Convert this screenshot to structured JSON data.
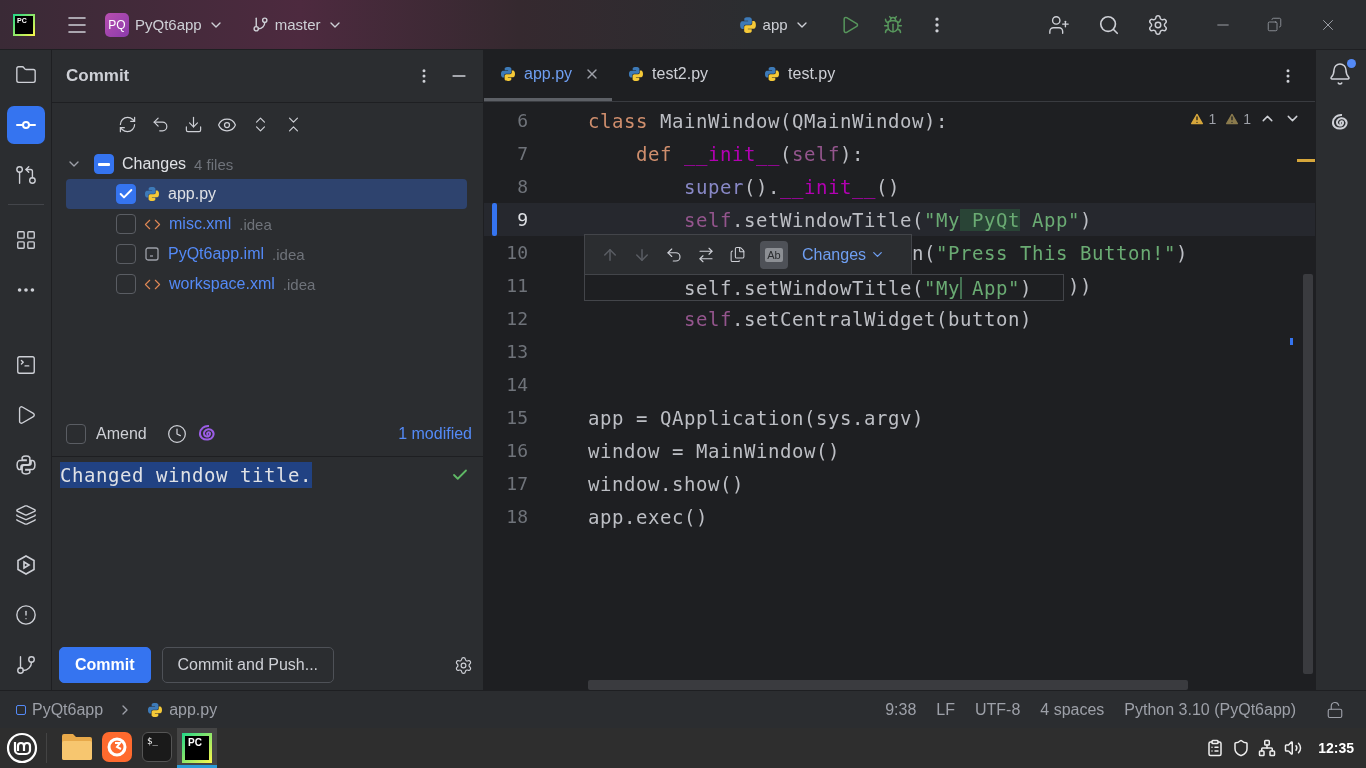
{
  "title_bar": {
    "logo_text": "PC",
    "project": {
      "badge": "PQ",
      "name": "PyQt6app"
    },
    "branch": "master",
    "run_config": "app"
  },
  "tool_strip": {
    "top": [
      {
        "selected": false
      },
      {
        "selected": true
      },
      {
        "selected": false
      },
      {
        "selected": false
      },
      {
        "selected": false
      }
    ],
    "bottom": [
      {
        "selected": false
      },
      {
        "selected": false
      },
      {
        "selected": false
      },
      {
        "selected": false
      },
      {
        "selected": false
      },
      {
        "selected": false
      },
      {
        "selected": false
      }
    ]
  },
  "commit_panel": {
    "title": "Commit",
    "group": {
      "label": "Changes",
      "count": "4 files",
      "expanded": true,
      "partial": true
    },
    "files": [
      {
        "name": "app.py",
        "kind": "python",
        "checked": true,
        "selected": true
      },
      {
        "name": "misc.xml",
        "dir": ".idea",
        "kind": "xml",
        "checked": false,
        "selected": false
      },
      {
        "name": "PyQt6app.iml",
        "dir": ".idea",
        "kind": "iml",
        "checked": false,
        "selected": false
      },
      {
        "name": "workspace.xml",
        "dir": ".idea",
        "kind": "xml",
        "checked": false,
        "selected": false
      }
    ],
    "amend": {
      "label": "Amend",
      "checked": false
    },
    "modified_link": "1 modified",
    "message": "Changed window title.",
    "buttons": [
      {
        "label": "Commit",
        "kind": "primary"
      },
      {
        "label": "Commit and Push...",
        "kind": "secondary"
      }
    ]
  },
  "editor": {
    "tabs": [
      {
        "label": "app.py",
        "selected": true
      },
      {
        "label": "test2.py",
        "selected": false
      },
      {
        "label": "test.py",
        "selected": false
      }
    ],
    "inspections": [
      {
        "count": "1",
        "kind": "warning"
      },
      {
        "count": "1",
        "kind": "weak_warning"
      }
    ],
    "lines": [
      {
        "number": "6",
        "tokens": [
          {
            "t": "class ",
            "kind": "keyword"
          },
          {
            "t": "MainWindow(QMainWindow):",
            "kind": "plain"
          }
        ]
      },
      {
        "number": "7",
        "tokens": [
          {
            "t": "    def ",
            "kind": "keyword"
          },
          {
            "t": "__init__",
            "kind": "magic"
          },
          {
            "t": "(",
            "kind": "plain"
          },
          {
            "t": "self",
            "kind": "self"
          },
          {
            "t": "):",
            "kind": "plain"
          }
        ]
      },
      {
        "number": "8",
        "tokens": [
          {
            "t": "        super",
            "kind": "builtin"
          },
          {
            "t": "().",
            "kind": "plain"
          },
          {
            "t": "__init__",
            "kind": "magic"
          },
          {
            "t": "()",
            "kind": "plain"
          }
        ]
      },
      {
        "number": "9",
        "current": true,
        "changed": true,
        "tokens": [
          {
            "t": "        self",
            "kind": "self"
          },
          {
            "t": ".setWindowTitle(",
            "kind": "plain"
          },
          {
            "t": "\"My",
            "kind": "string"
          },
          {
            "t": " PyQt",
            "kind": "string",
            "highlight": true
          },
          {
            "t": " App\"",
            "kind": "string"
          },
          {
            "t": ")",
            "kind": "plain"
          }
        ]
      },
      {
        "number": "10",
        "tokens": [
          {
            "t": "                           n(",
            "kind": "plain"
          },
          {
            "t": "\"Press This Button!\"",
            "kind": "string"
          },
          {
            "t": ")",
            "kind": "plain"
          }
        ]
      },
      {
        "number": "11",
        "tokens": [
          {
            "t": "                                        ))",
            "kind": "plain"
          }
        ]
      },
      {
        "number": "12",
        "tokens": [
          {
            "t": "        self",
            "kind": "self"
          },
          {
            "t": ".setCentralWidget(button)",
            "kind": "plain"
          }
        ]
      },
      {
        "number": "13"
      },
      {
        "number": "14"
      },
      {
        "number": "15",
        "tokens": [
          {
            "t": "app = QApplication(sys.argv)",
            "kind": "plain"
          }
        ]
      },
      {
        "number": "16",
        "tokens": [
          {
            "t": "window = MainWindow()",
            "kind": "plain"
          }
        ]
      },
      {
        "number": "17",
        "tokens": [
          {
            "t": "window.show()",
            "kind": "plain"
          }
        ]
      },
      {
        "number": "18",
        "tokens": [
          {
            "t": "app.exec()",
            "kind": "plain"
          }
        ]
      }
    ],
    "diff_popup": {
      "ignore_case": {
        "label": "Ab",
        "on": true
      },
      "dropdown": "Changes",
      "tokens": [
        {
          "t": "self.setWindowTitle(",
          "kind": "plain"
        },
        {
          "t": "\"My",
          "kind": "string"
        },
        {
          "t": " App\"",
          "kind": "string",
          "gap_before": true
        },
        {
          "t": ")",
          "kind": "plain"
        }
      ]
    }
  },
  "status_bar": {
    "breadcrumbs": [
      {
        "label": "PyQt6app",
        "kind": "module"
      },
      {
        "label": "app.py",
        "kind": "python"
      }
    ],
    "items": [
      "9:38",
      "LF",
      "UTF-8",
      "4 spaces",
      "Python 3.10 (PyQt6app)"
    ]
  },
  "taskbar": {
    "apps": [
      {
        "kind": "files",
        "active": false
      },
      {
        "kind": "browser",
        "active": false
      },
      {
        "kind": "terminal",
        "label": "$_",
        "active": false
      },
      {
        "kind": "ide",
        "label": "PC",
        "active": true
      }
    ],
    "clock": "12:35"
  }
}
